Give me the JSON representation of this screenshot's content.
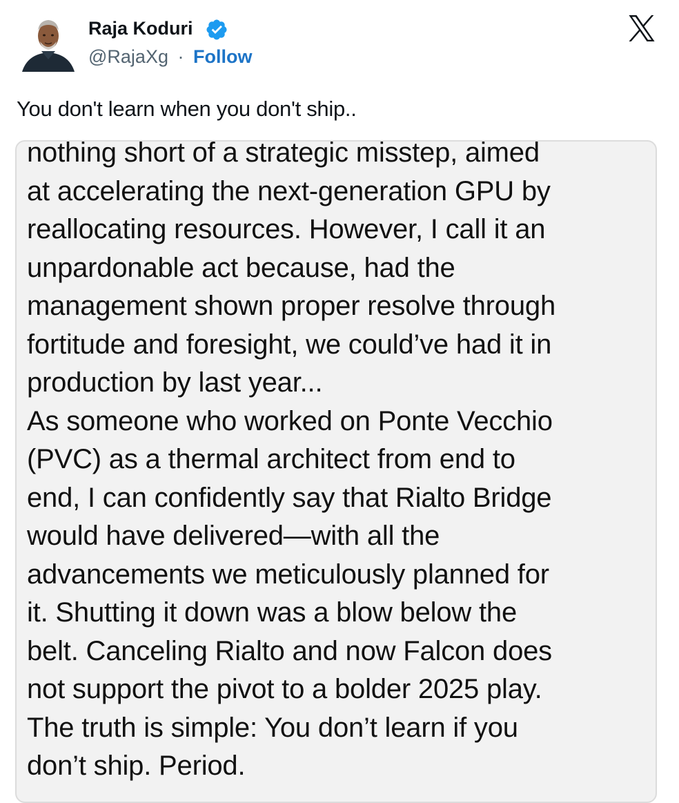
{
  "author": {
    "display_name": "Raja Koduri",
    "handle": "@RajaXg",
    "separator": "·",
    "follow_label": "Follow",
    "verified": true
  },
  "brand": {
    "logo_icon": "x-logo-icon"
  },
  "tweet": {
    "text": "You don't learn when you don't ship.."
  },
  "quoted_text": {
    "lines": [
      "nothing short of a strategic misstep, aimed",
      "at accelerating the next-generation GPU by",
      "reallocating resources. However, I call it an",
      "unpardonable act because, had the",
      "management shown proper resolve through",
      "fortitude and foresight, we could’ve had it in",
      "production by last year...",
      "As someone who worked on Ponte Vecchio",
      "(PVC) as a thermal architect from end to",
      "end, I can confidently say that Rialto Bridge",
      "would have delivered—with all the",
      "advancements we meticulously planned for",
      "it. Shutting it down was a blow below the",
      "belt. Canceling Rialto and now Falcon does",
      "not support the pivot to a bolder 2025 play.",
      "The truth is simple: You don’t learn if you",
      "don’t ship. Period."
    ]
  },
  "colors": {
    "verified_badge": "#1d9bf0",
    "follow_link": "#1d74c7",
    "quote_background": "#f2f2f2"
  }
}
